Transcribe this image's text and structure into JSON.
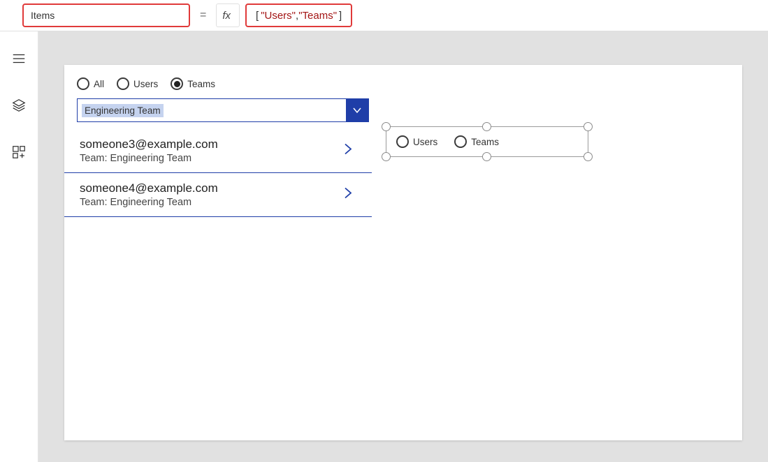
{
  "formula_bar": {
    "property": "Items",
    "fx_label": "fx",
    "formula_tokens": {
      "open": "[",
      "s1": "\"Users\"",
      "comma": ", ",
      "s2": "\"Teams\"",
      "close": "]"
    }
  },
  "left_rail": {
    "icons": [
      "menu",
      "layers",
      "insert"
    ]
  },
  "canvas": {
    "radio_group_top": {
      "selected_index": 2,
      "options": [
        "All",
        "Users",
        "Teams"
      ]
    },
    "dropdown": {
      "selected": "Engineering Team"
    },
    "list": [
      {
        "title": "someone3@example.com",
        "subtitle": "Team: Engineering Team"
      },
      {
        "title": "someone4@example.com",
        "subtitle": "Team: Engineering Team"
      }
    ],
    "selected_radio_control": {
      "options": [
        "Users",
        "Teams"
      ]
    }
  }
}
